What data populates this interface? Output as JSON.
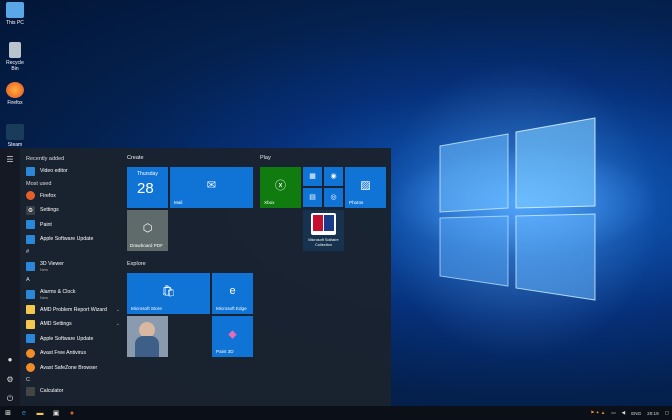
{
  "desktop": {
    "icons": [
      {
        "label": "This PC"
      },
      {
        "label": "Recycle Bin"
      },
      {
        "label": "Firefox"
      },
      {
        "label": "Steam"
      }
    ]
  },
  "start_menu": {
    "recently_added_header": "Recently added",
    "recent_apps": [
      {
        "label": "Video editor"
      }
    ],
    "most_used_header": "Most used",
    "most_used": [
      {
        "label": "Firefox"
      },
      {
        "label": "Settings"
      },
      {
        "label": "Paint"
      },
      {
        "label": "Apple Software Update"
      }
    ],
    "sections": [
      {
        "letter": "#",
        "apps": [
          {
            "label": "3D Viewer",
            "sub": "New"
          }
        ]
      },
      {
        "letter": "A",
        "apps": [
          {
            "label": "Alarms & Clock",
            "sub": "New"
          },
          {
            "label": "AMD Problem Report Wizard",
            "chev": "⌄"
          },
          {
            "label": "AMD Settings",
            "chev": "⌄"
          },
          {
            "label": "Apple Software Update"
          },
          {
            "label": "Avast Free Antivirus"
          },
          {
            "label": "Avast SafeZone Browser"
          }
        ]
      },
      {
        "letter": "C",
        "apps": [
          {
            "label": "Calculator"
          }
        ]
      }
    ],
    "groups": {
      "create": "Create",
      "play": "Play",
      "explore": "Explore"
    },
    "tiles": {
      "calendar_day": "Thursday",
      "calendar_date": "28",
      "mail": "Mail",
      "xbox": "Xbox",
      "photos": "Photos",
      "dropdown_pdf": "Drawboard PDF",
      "solitaire": "Microsoft Solitaire Collection",
      "store": "Microsoft Store",
      "edge": "Microsoft Edge",
      "paint3d": "Paint 3D"
    }
  },
  "taskbar": {
    "language": "ENG",
    "time": "20:19"
  }
}
